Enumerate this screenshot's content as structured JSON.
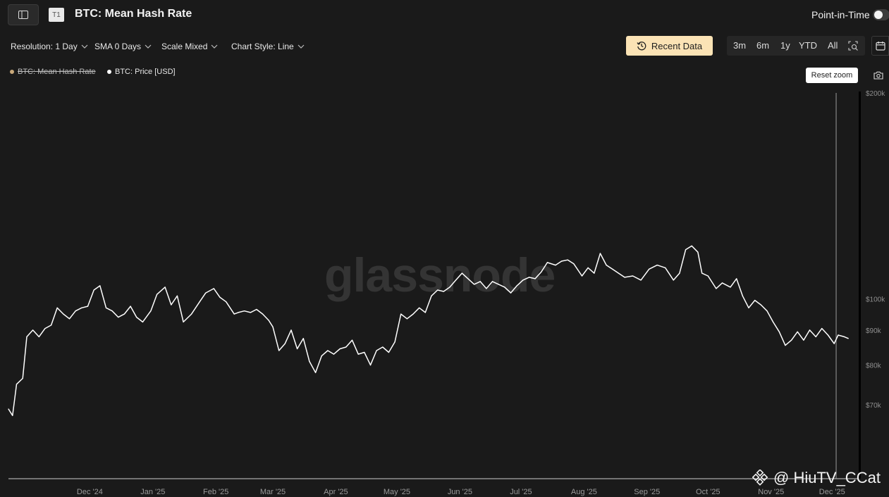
{
  "header": {
    "sidebar_icon": "sidebar-toggle-icon",
    "tier_badge": "T1",
    "title": "BTC: Mean Hash Rate",
    "point_in_time_label": "Point-in-Time",
    "point_in_time_enabled": false
  },
  "controls": {
    "resolution": "Resolution: 1 Day",
    "sma": "SMA 0 Days",
    "scale": "Scale Mixed",
    "chart_style": "Chart Style: Line",
    "recent_data": "Recent Data",
    "ranges": [
      "3m",
      "6m",
      "1y",
      "YTD",
      "All"
    ],
    "zoom_icon": "zoom-select-icon",
    "calendar_icon": "calendar-icon"
  },
  "legend": [
    {
      "label": "BTC: Mean Hash Rate",
      "color": "#c9a97a",
      "hidden": true
    },
    {
      "label": "BTC: Price [USD]",
      "color": "#ffffff",
      "hidden": false
    }
  ],
  "reset_zoom": "Reset zoom",
  "camera_icon": "camera-icon",
  "watermark": "glassnode",
  "credit": "@ HiuTV_CCat",
  "colors": {
    "background": "#1a1a1a",
    "price_line": "#ffffff",
    "accent": "#fbe3b5"
  },
  "chart_data": {
    "type": "line",
    "title": "BTC: Mean Hash Rate",
    "scale": "log",
    "ylim": [
      60000,
      200000
    ],
    "y_ticks": [
      {
        "value": 200000,
        "label": "$200k"
      },
      {
        "value": 100000,
        "label": "$100k"
      },
      {
        "value": 90000,
        "label": "$90k"
      },
      {
        "value": 80000,
        "label": "$80k"
      },
      {
        "value": 70000,
        "label": "$70k"
      }
    ],
    "x_ticks": [
      "Dec '24",
      "Jan '25",
      "Feb '25",
      "Mar '25",
      "Apr '25",
      "May '25",
      "Jun '25",
      "Jul '25",
      "Aug '25",
      "Sep '25",
      "Oct '25",
      "Nov '25",
      "Dec '25"
    ],
    "xlim": [
      "2024-11-05",
      "2025-12-26"
    ],
    "crosshair_date": "2025-12-17",
    "series": [
      {
        "name": "BTC: Price [USD]",
        "color": "#ffffff",
        "points": [
          [
            "2024-11-05",
            69000
          ],
          [
            "2024-11-07",
            67500
          ],
          [
            "2024-11-09",
            75000
          ],
          [
            "2024-11-12",
            76500
          ],
          [
            "2024-11-14",
            88000
          ],
          [
            "2024-11-17",
            90000
          ],
          [
            "2024-11-20",
            88000
          ],
          [
            "2024-11-23",
            90500
          ],
          [
            "2024-11-26",
            91500
          ],
          [
            "2024-11-29",
            97000
          ],
          [
            "2024-12-02",
            95000
          ],
          [
            "2024-12-05",
            93500
          ],
          [
            "2024-12-08",
            96000
          ],
          [
            "2024-12-11",
            97000
          ],
          [
            "2024-12-14",
            97500
          ],
          [
            "2024-12-17",
            103000
          ],
          [
            "2024-12-20",
            104500
          ],
          [
            "2024-12-23",
            97000
          ],
          [
            "2024-12-26",
            96000
          ],
          [
            "2024-12-29",
            94000
          ],
          [
            "2025-01-01",
            95000
          ],
          [
            "2025-01-04",
            97500
          ],
          [
            "2025-01-07",
            94000
          ],
          [
            "2025-01-10",
            92500
          ],
          [
            "2025-01-14",
            96000
          ],
          [
            "2025-01-17",
            101500
          ],
          [
            "2025-01-21",
            104000
          ],
          [
            "2025-01-24",
            98000
          ],
          [
            "2025-01-27",
            101000
          ],
          [
            "2025-01-30",
            92500
          ],
          [
            "2025-02-03",
            95000
          ],
          [
            "2025-02-07",
            99000
          ],
          [
            "2025-02-10",
            102000
          ],
          [
            "2025-02-14",
            103500
          ],
          [
            "2025-02-17",
            100500
          ],
          [
            "2025-02-20",
            99000
          ],
          [
            "2025-02-24",
            95000
          ],
          [
            "2025-02-26",
            95500
          ],
          [
            "2025-03-01",
            96000
          ],
          [
            "2025-03-04",
            95500
          ],
          [
            "2025-03-07",
            96500
          ],
          [
            "2025-03-10",
            95000
          ],
          [
            "2025-03-13",
            93000
          ],
          [
            "2025-03-15",
            91000
          ],
          [
            "2025-03-18",
            84000
          ],
          [
            "2025-03-21",
            86000
          ],
          [
            "2025-03-24",
            90000
          ],
          [
            "2025-03-27",
            84500
          ],
          [
            "2025-03-30",
            87500
          ],
          [
            "2025-04-02",
            81000
          ],
          [
            "2025-04-05",
            78000
          ],
          [
            "2025-04-08",
            82500
          ],
          [
            "2025-04-11",
            84000
          ],
          [
            "2025-04-14",
            83000
          ],
          [
            "2025-04-17",
            84500
          ],
          [
            "2025-04-20",
            85000
          ],
          [
            "2025-04-23",
            87000
          ],
          [
            "2025-04-26",
            83000
          ],
          [
            "2025-04-29",
            83500
          ],
          [
            "2025-05-02",
            80000
          ],
          [
            "2025-05-05",
            84000
          ],
          [
            "2025-05-08",
            85000
          ],
          [
            "2025-05-11",
            83500
          ],
          [
            "2025-05-14",
            86500
          ],
          [
            "2025-05-17",
            95000
          ],
          [
            "2025-05-20",
            93500
          ],
          [
            "2025-05-23",
            95000
          ],
          [
            "2025-05-26",
            97000
          ],
          [
            "2025-05-29",
            95500
          ],
          [
            "2025-06-01",
            101000
          ],
          [
            "2025-06-04",
            103000
          ],
          [
            "2025-06-07",
            102500
          ],
          [
            "2025-06-10",
            104000
          ],
          [
            "2025-06-13",
            106500
          ],
          [
            "2025-06-16",
            109000
          ],
          [
            "2025-06-19",
            107000
          ],
          [
            "2025-06-22",
            105000
          ],
          [
            "2025-06-25",
            106000
          ],
          [
            "2025-06-28",
            103500
          ],
          [
            "2025-07-01",
            106000
          ],
          [
            "2025-07-04",
            105000
          ],
          [
            "2025-07-07",
            104000
          ],
          [
            "2025-07-10",
            102000
          ],
          [
            "2025-07-13",
            104500
          ],
          [
            "2025-07-16",
            106500
          ],
          [
            "2025-07-19",
            107500
          ],
          [
            "2025-07-22",
            107000
          ],
          [
            "2025-07-25",
            109500
          ],
          [
            "2025-07-28",
            113000
          ],
          [
            "2025-08-01",
            112000
          ],
          [
            "2025-08-04",
            113500
          ],
          [
            "2025-08-07",
            114000
          ],
          [
            "2025-08-10",
            112500
          ],
          [
            "2025-08-14",
            108000
          ],
          [
            "2025-08-17",
            111000
          ],
          [
            "2025-08-20",
            109000
          ],
          [
            "2025-08-23",
            116500
          ],
          [
            "2025-08-26",
            112000
          ],
          [
            "2025-08-29",
            110500
          ],
          [
            "2025-09-01",
            109000
          ],
          [
            "2025-09-04",
            107500
          ],
          [
            "2025-09-08",
            108000
          ],
          [
            "2025-09-12",
            106500
          ],
          [
            "2025-09-16",
            110500
          ],
          [
            "2025-09-20",
            112000
          ],
          [
            "2025-09-24",
            111000
          ],
          [
            "2025-09-28",
            106500
          ],
          [
            "2025-10-01",
            109000
          ],
          [
            "2025-10-04",
            118000
          ],
          [
            "2025-10-07",
            119500
          ],
          [
            "2025-10-10",
            117000
          ],
          [
            "2025-10-12",
            109000
          ],
          [
            "2025-10-15",
            108000
          ],
          [
            "2025-10-19",
            103500
          ],
          [
            "2025-10-22",
            105500
          ],
          [
            "2025-10-26",
            104000
          ],
          [
            "2025-10-29",
            107000
          ],
          [
            "2025-11-01",
            101000
          ],
          [
            "2025-11-04",
            97000
          ],
          [
            "2025-11-07",
            99500
          ],
          [
            "2025-11-10",
            98000
          ],
          [
            "2025-11-13",
            96000
          ],
          [
            "2025-11-16",
            92500
          ],
          [
            "2025-11-19",
            89500
          ],
          [
            "2025-11-22",
            85500
          ],
          [
            "2025-11-25",
            87000
          ],
          [
            "2025-11-28",
            89500
          ],
          [
            "2025-12-01",
            87000
          ],
          [
            "2025-12-04",
            90000
          ],
          [
            "2025-12-07",
            88000
          ],
          [
            "2025-12-10",
            90500
          ],
          [
            "2025-12-13",
            88500
          ],
          [
            "2025-12-16",
            86000
          ],
          [
            "2025-12-18",
            88500
          ],
          [
            "2025-12-21",
            88000
          ],
          [
            "2025-12-23",
            87500
          ]
        ]
      }
    ]
  }
}
